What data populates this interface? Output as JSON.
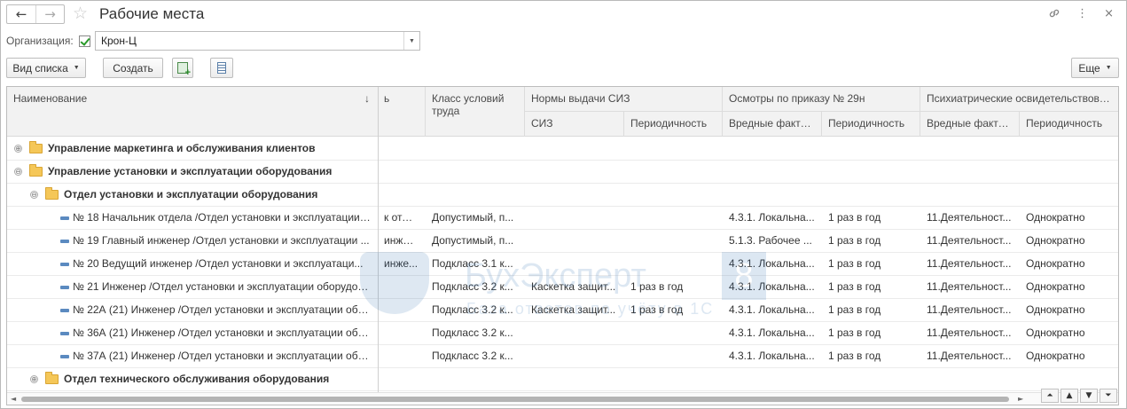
{
  "window": {
    "title": "Рабочие места",
    "back_icon": "←",
    "forward_icon": "→",
    "favorite_icon": "☆",
    "link_icon": "🔗",
    "more_icon": "⋮",
    "close_icon": "×"
  },
  "filter": {
    "org_label": "Организация:",
    "org_checked": true,
    "org_value": "Крон-Ц",
    "dropdown_icon": "▼"
  },
  "toolbar": {
    "view_list_label": "Вид списка",
    "create_label": "Создать",
    "more_label": "Еще",
    "caret": "▼"
  },
  "columns": {
    "name": "Наименование",
    "sort_icon": "↓",
    "partial": "ь",
    "class": "Класс условий труда",
    "siz_group": "Нормы выдачи СИЗ",
    "siz": "СИЗ",
    "siz_period": "Периодичность",
    "exam_group": "Осмотры по приказу № 29н",
    "exam_factors": "Вредные факторы",
    "exam_period": "Периодичность",
    "psych_group": "Психиатрические освидетельствова...",
    "psych_factors": "Вредные факторы",
    "psych_period": "Периодичность"
  },
  "rows": [
    {
      "name": "Управление маркетинга и обслуживания клиентов",
      "type": "folder",
      "level": 0,
      "toggle": "⊕",
      "partial": "",
      "class": "",
      "siz": "",
      "siz_period": "",
      "exam_factors": "",
      "exam_period": "",
      "psych_factors": "",
      "psych_period": ""
    },
    {
      "name": "Управление установки и эксплуатации оборудования",
      "type": "folder",
      "level": 0,
      "toggle": "⊖",
      "partial": "",
      "class": "",
      "siz": "",
      "siz_period": "",
      "exam_factors": "",
      "exam_period": "",
      "psych_factors": "",
      "psych_period": ""
    },
    {
      "name": "Отдел установки и эксплуатации оборудования",
      "type": "folder",
      "level": 1,
      "toggle": "⊖",
      "partial": "",
      "class": "",
      "siz": "",
      "siz_period": "",
      "exam_factors": "",
      "exam_period": "",
      "psych_factors": "",
      "psych_period": ""
    },
    {
      "name": "№ 18 Начальник отдела /Отдел установки и эксплуатации ...",
      "type": "item",
      "level": 2,
      "toggle": "",
      "partial": "к отде...",
      "class": "Допустимый, п...",
      "siz": "",
      "siz_period": "",
      "exam_factors": "4.3.1. Локальна...",
      "exam_period": "1 раз в год",
      "psych_factors": "11.Деятельност...",
      "psych_period": "Однократно"
    },
    {
      "name": "№ 19 Главный инженер /Отдел установки и эксплуатации ...",
      "type": "item",
      "level": 2,
      "toggle": "",
      "partial": "инженер",
      "class": "Допустимый, п...",
      "siz": "",
      "siz_period": "",
      "exam_factors": "5.1.3. Рабочее ...",
      "exam_period": "1 раз в год",
      "psych_factors": "11.Деятельност...",
      "psych_period": "Однократно"
    },
    {
      "name": "№ 20 Ведущий инженер /Отдел установки и эксплуатаци...",
      "type": "item",
      "level": 2,
      "toggle": "",
      "partial": "инже...",
      "class": "Подкласс 3.1 к...",
      "siz": "",
      "siz_period": "",
      "exam_factors": "4.3.1. Локальна...",
      "exam_period": "1 раз в год",
      "psych_factors": "11.Деятельност...",
      "psych_period": "Однократно"
    },
    {
      "name": "№ 21 Инженер /Отдел установки и эксплуатации оборудов...",
      "type": "item",
      "level": 2,
      "toggle": "",
      "partial": "",
      "class": "Подкласс 3.2 к...",
      "siz": "Каскетка защит...",
      "siz_period": "1 раз в год",
      "exam_factors": "4.3.1. Локальна...",
      "exam_period": "1 раз в год",
      "psych_factors": "11.Деятельност...",
      "psych_period": "Однократно"
    },
    {
      "name": "№ 22А (21) Инженер /Отдел установки и эксплуатации обо...",
      "type": "item",
      "level": 2,
      "toggle": "",
      "partial": "",
      "class": "Подкласс 3.2 к...",
      "siz": "Каскетка защит...",
      "siz_period": "1 раз в год",
      "exam_factors": "4.3.1. Локальна...",
      "exam_period": "1 раз в год",
      "psych_factors": "11.Деятельност...",
      "psych_period": "Однократно"
    },
    {
      "name": "№ 36А (21) Инженер /Отдел установки и эксплуатации обо...",
      "type": "item",
      "level": 2,
      "toggle": "",
      "partial": "",
      "class": "Подкласс 3.2 к...",
      "siz": "",
      "siz_period": "",
      "exam_factors": "4.3.1. Локальна...",
      "exam_period": "1 раз в год",
      "psych_factors": "11.Деятельност...",
      "psych_period": "Однократно"
    },
    {
      "name": "№ 37А (21) Инженер /Отдел установки и эксплуатации обо...",
      "type": "item",
      "level": 2,
      "toggle": "",
      "partial": "",
      "class": "Подкласс 3.2 к...",
      "siz": "",
      "siz_period": "",
      "exam_factors": "4.3.1. Локальна...",
      "exam_period": "1 раз в год",
      "psych_factors": "11.Деятельност...",
      "psych_period": "Однократно"
    },
    {
      "name": "Отдел технического обслуживания оборудования",
      "type": "folder",
      "level": 1,
      "toggle": "⊕",
      "partial": "",
      "class": "",
      "siz": "",
      "siz_period": "",
      "exam_factors": "",
      "exam_period": "",
      "psych_factors": "",
      "psych_period": ""
    }
  ],
  "watermark": {
    "brand": "БухЭксперт",
    "number": "8",
    "subtitle": "База ответов по учёту в 1С"
  },
  "scroll": {
    "left_icon": "◄",
    "right_icon": "►",
    "first_icon": "⏶",
    "up_icon": "▲",
    "down_icon": "▼",
    "last_icon": "⏷"
  }
}
